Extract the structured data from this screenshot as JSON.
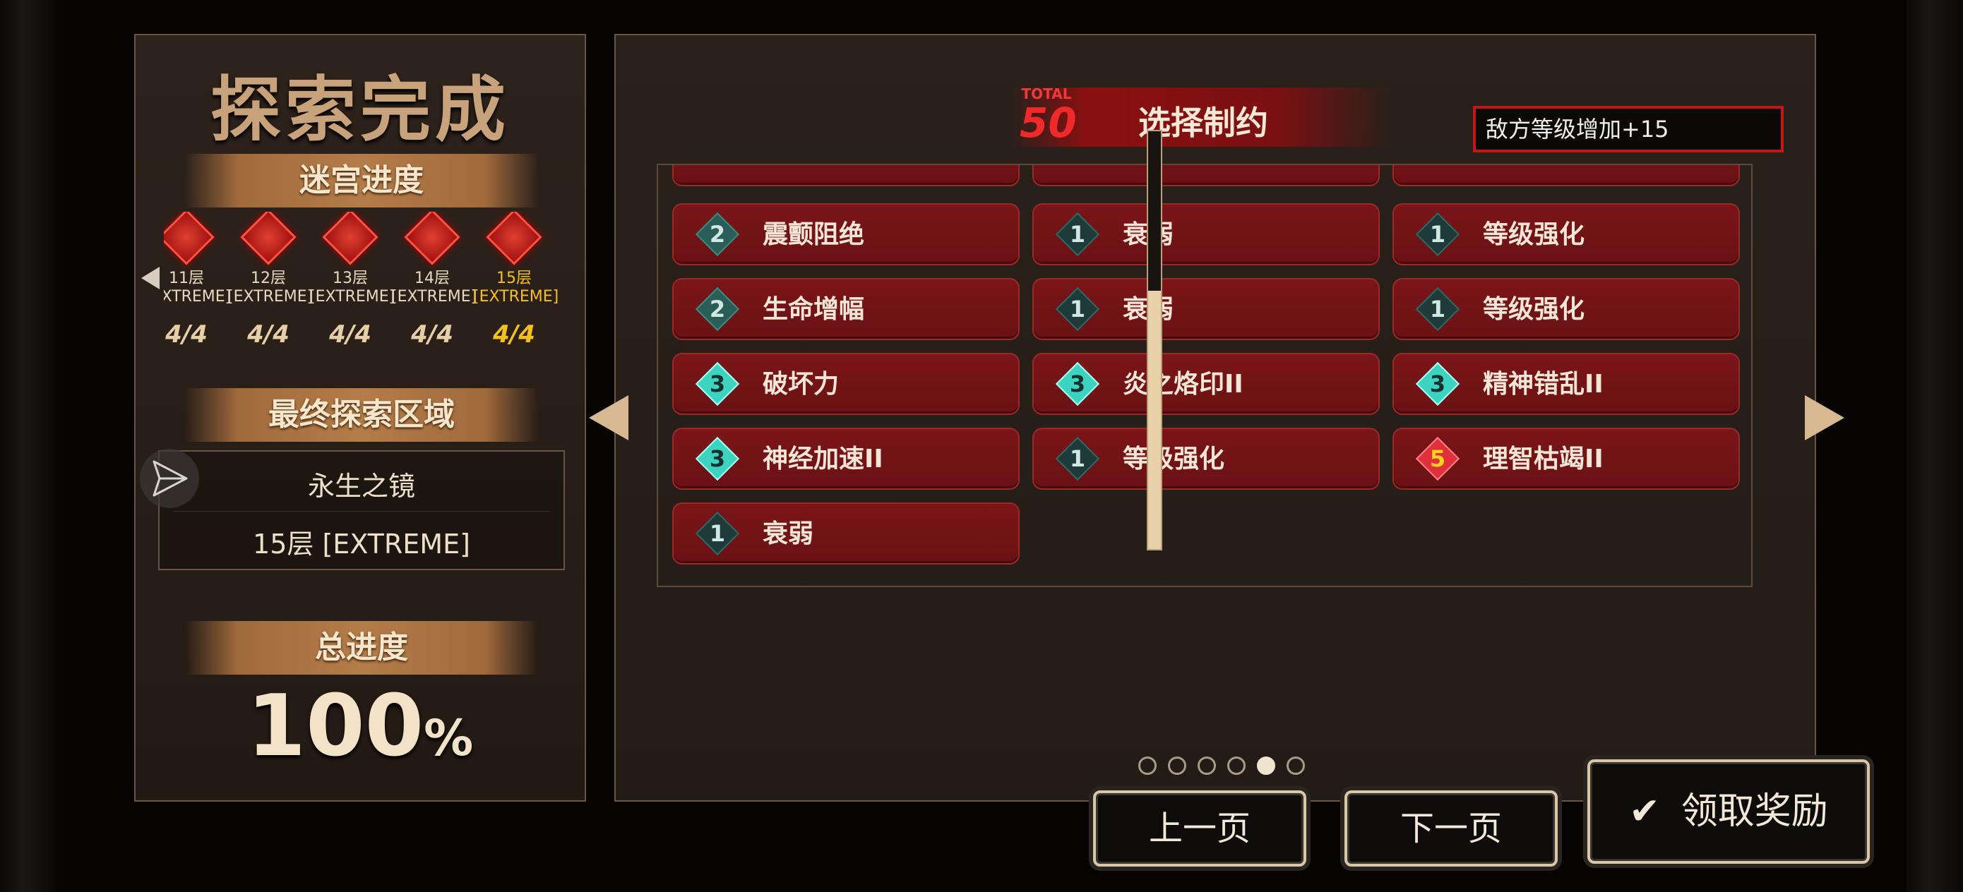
{
  "left": {
    "title": "探索完成",
    "progress_header": "迷宫进度",
    "floors": [
      {
        "floor": "11层",
        "mode": "[EXTREME]",
        "count": "4/4"
      },
      {
        "floor": "12层",
        "mode": "[EXTREME]",
        "count": "4/4"
      },
      {
        "floor": "13层",
        "mode": "[EXTREME]",
        "count": "4/4"
      },
      {
        "floor": "14层",
        "mode": "[EXTREME]",
        "count": "4/4"
      },
      {
        "floor": "15层",
        "mode": "[EXTREME]",
        "count": "4/4"
      }
    ],
    "final_zone_header": "最终探索区域",
    "zone_name": "永生之镜",
    "zone_floor": "15层 [EXTREME]",
    "total_header": "总进度",
    "total_value": "100",
    "total_unit": "%"
  },
  "right": {
    "total_label": "TOTAL",
    "total_value": "50",
    "title": "选择制约",
    "effect": "敌方等级增加+15",
    "constraints": [
      {
        "level": "2",
        "name": "震颤阻绝"
      },
      {
        "level": "1",
        "name": "衰弱"
      },
      {
        "level": "1",
        "name": "等级强化"
      },
      {
        "level": "2",
        "name": "生命增幅"
      },
      {
        "level": "1",
        "name": "衰弱"
      },
      {
        "level": "1",
        "name": "等级强化"
      },
      {
        "level": "3",
        "name": "破坏力"
      },
      {
        "level": "3",
        "name": "炎之烙印II"
      },
      {
        "level": "3",
        "name": "精神错乱II"
      },
      {
        "level": "3",
        "name": "神经加速II"
      },
      {
        "level": "1",
        "name": "等级强化"
      },
      {
        "level": "5",
        "name": "理智枯竭II"
      },
      {
        "level": "1",
        "name": "衰弱"
      }
    ],
    "page": {
      "current": 5,
      "total": 6
    }
  },
  "buttons": {
    "prev": "上一页",
    "next": "下一页",
    "claim": "领取奖励"
  },
  "colors": {
    "accent_red": "#c01818",
    "current_floor": "#f3c020"
  }
}
